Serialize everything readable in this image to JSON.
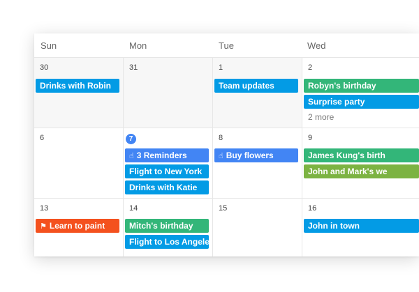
{
  "colors": {
    "blue": "#039be5",
    "green": "#33b679",
    "olive": "#7cb342",
    "orange": "#f4511e",
    "reminder_blue": "#4285f4",
    "today_badge": "#4285f4"
  },
  "weekdays": [
    "Sun",
    "Mon",
    "Tue",
    "Wed"
  ],
  "weeks": [
    {
      "days": [
        {
          "date": "30",
          "muted": true,
          "events": [
            {
              "label": "Drinks with Robin",
              "color": "blue"
            }
          ]
        },
        {
          "date": "31",
          "muted": true,
          "events": []
        },
        {
          "date": "1",
          "muted": true,
          "events": [
            {
              "label": "Team updates",
              "color": "blue"
            }
          ]
        },
        {
          "date": "2",
          "muted": false,
          "events": [
            {
              "label": "Robyn's birthday",
              "color": "green"
            },
            {
              "label": "Surprise party",
              "color": "blue"
            }
          ],
          "more": "2 more"
        }
      ]
    },
    {
      "days": [
        {
          "date": "6",
          "muted": false,
          "events": []
        },
        {
          "date": "7",
          "today": true,
          "events": [
            {
              "label": "3 Reminders",
              "color": "reminder_blue",
              "icon": "reminder-hand-icon"
            },
            {
              "label": "Flight to New York",
              "color": "blue"
            },
            {
              "label": "Drinks with Katie",
              "color": "blue"
            }
          ]
        },
        {
          "date": "8",
          "events": [
            {
              "label": "Buy flowers",
              "color": "reminder_blue",
              "icon": "reminder-hand-icon"
            }
          ]
        },
        {
          "date": "9",
          "events": [
            {
              "label": "James Kung's birth",
              "color": "green"
            },
            {
              "label": "John and Mark's we",
              "color": "olive"
            }
          ]
        }
      ]
    },
    {
      "days": [
        {
          "date": "13",
          "events": [
            {
              "label": "Learn to paint",
              "color": "orange",
              "icon": "flag-icon"
            }
          ]
        },
        {
          "date": "14",
          "events": [
            {
              "label": "Mitch's birthday",
              "color": "green"
            },
            {
              "label": "Flight to Los Angele",
              "color": "blue"
            }
          ]
        },
        {
          "date": "15",
          "events": []
        },
        {
          "date": "16",
          "events": [
            {
              "label": "John in town",
              "color": "blue"
            }
          ]
        }
      ]
    }
  ]
}
